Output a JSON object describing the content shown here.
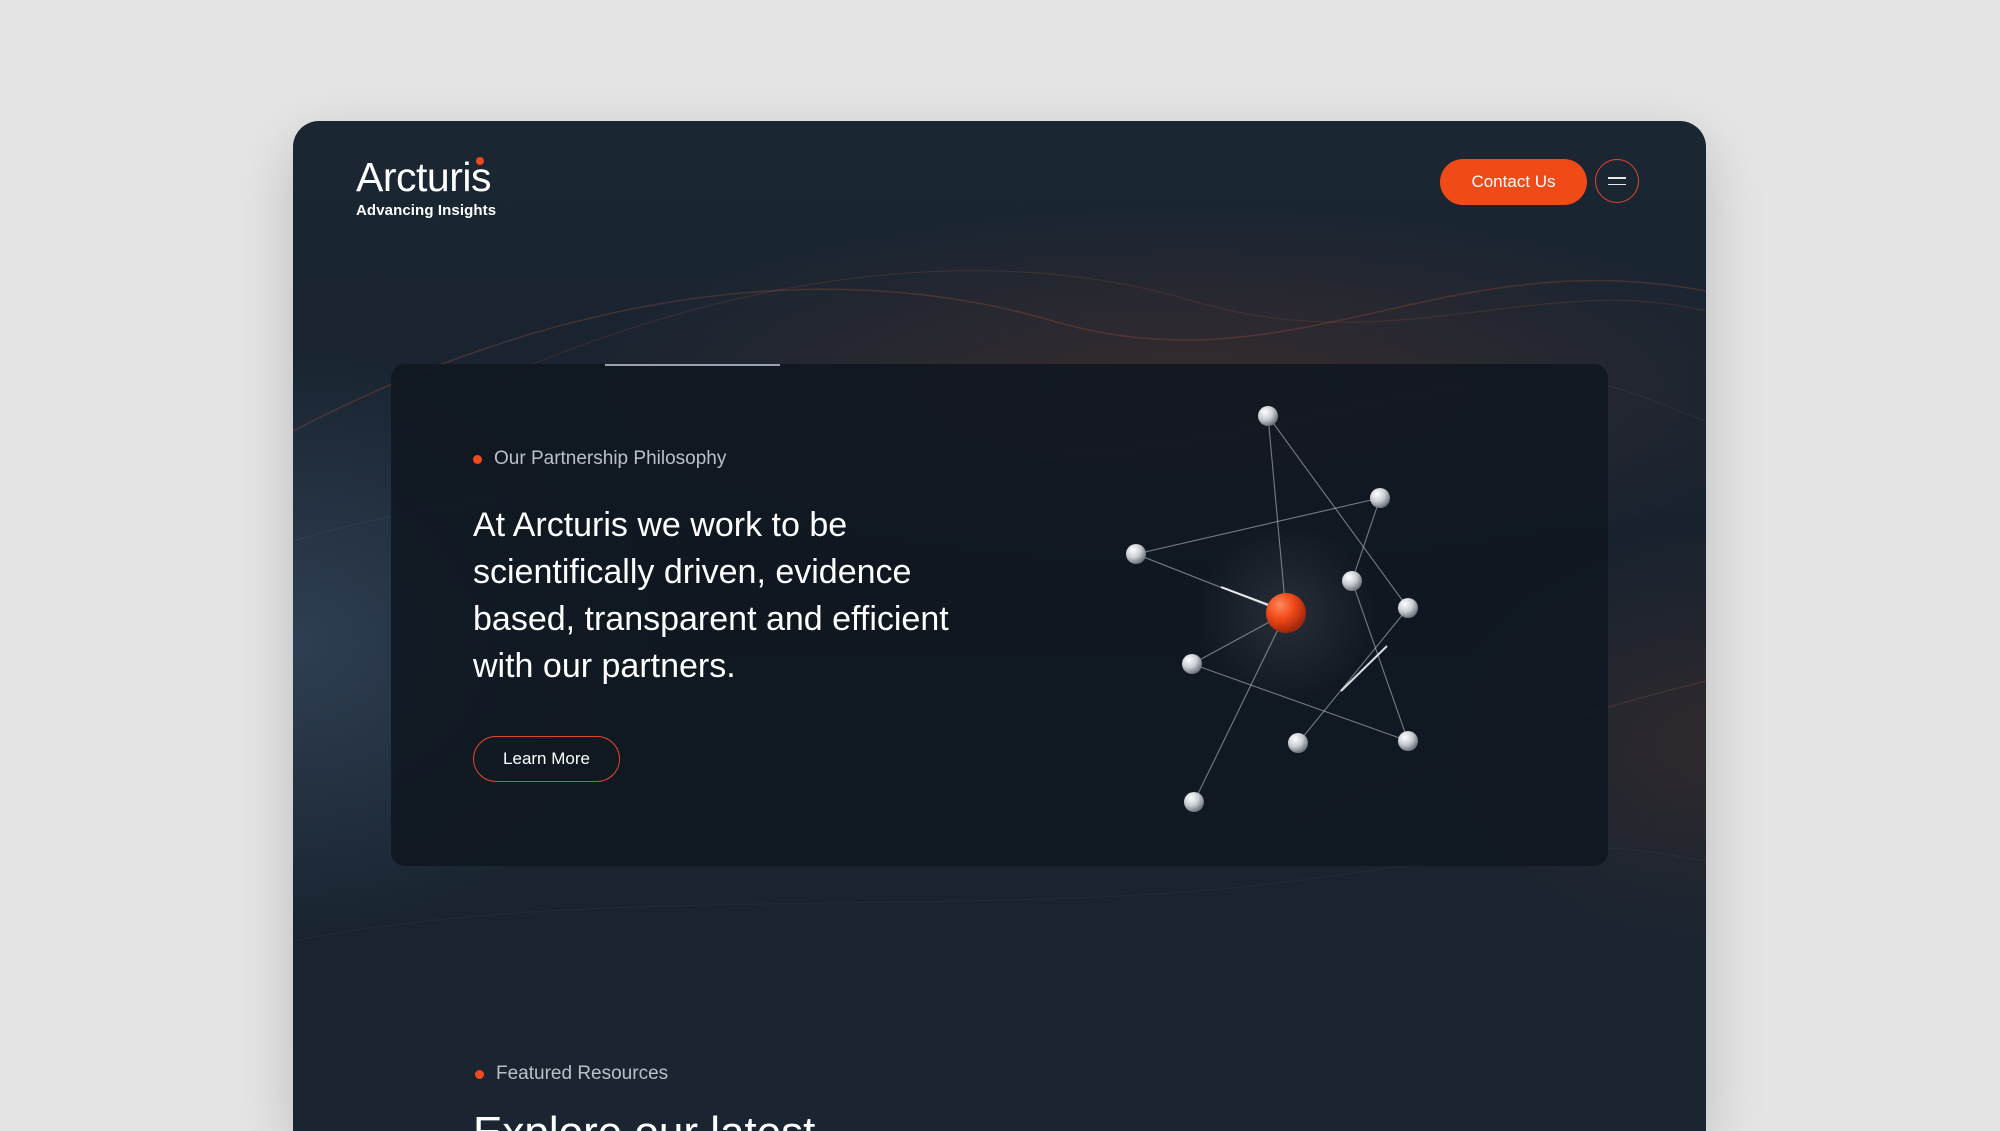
{
  "brand": {
    "name": "Arcturis",
    "tagline": "Advancing Insights",
    "accent_color": "#f04a18"
  },
  "header": {
    "contact_label": "Contact Us",
    "menu_icon": "hamburger-icon"
  },
  "hero_card": {
    "eyebrow": "Our Partnership Philosophy",
    "headline": "At Arcturis we work to be scientifically driven, evidence based, transparent and efficient with our partners.",
    "cta_label": "Learn More",
    "illustration": "molecule-network"
  },
  "featured": {
    "eyebrow": "Featured Resources",
    "heading": "Explore our latest"
  }
}
